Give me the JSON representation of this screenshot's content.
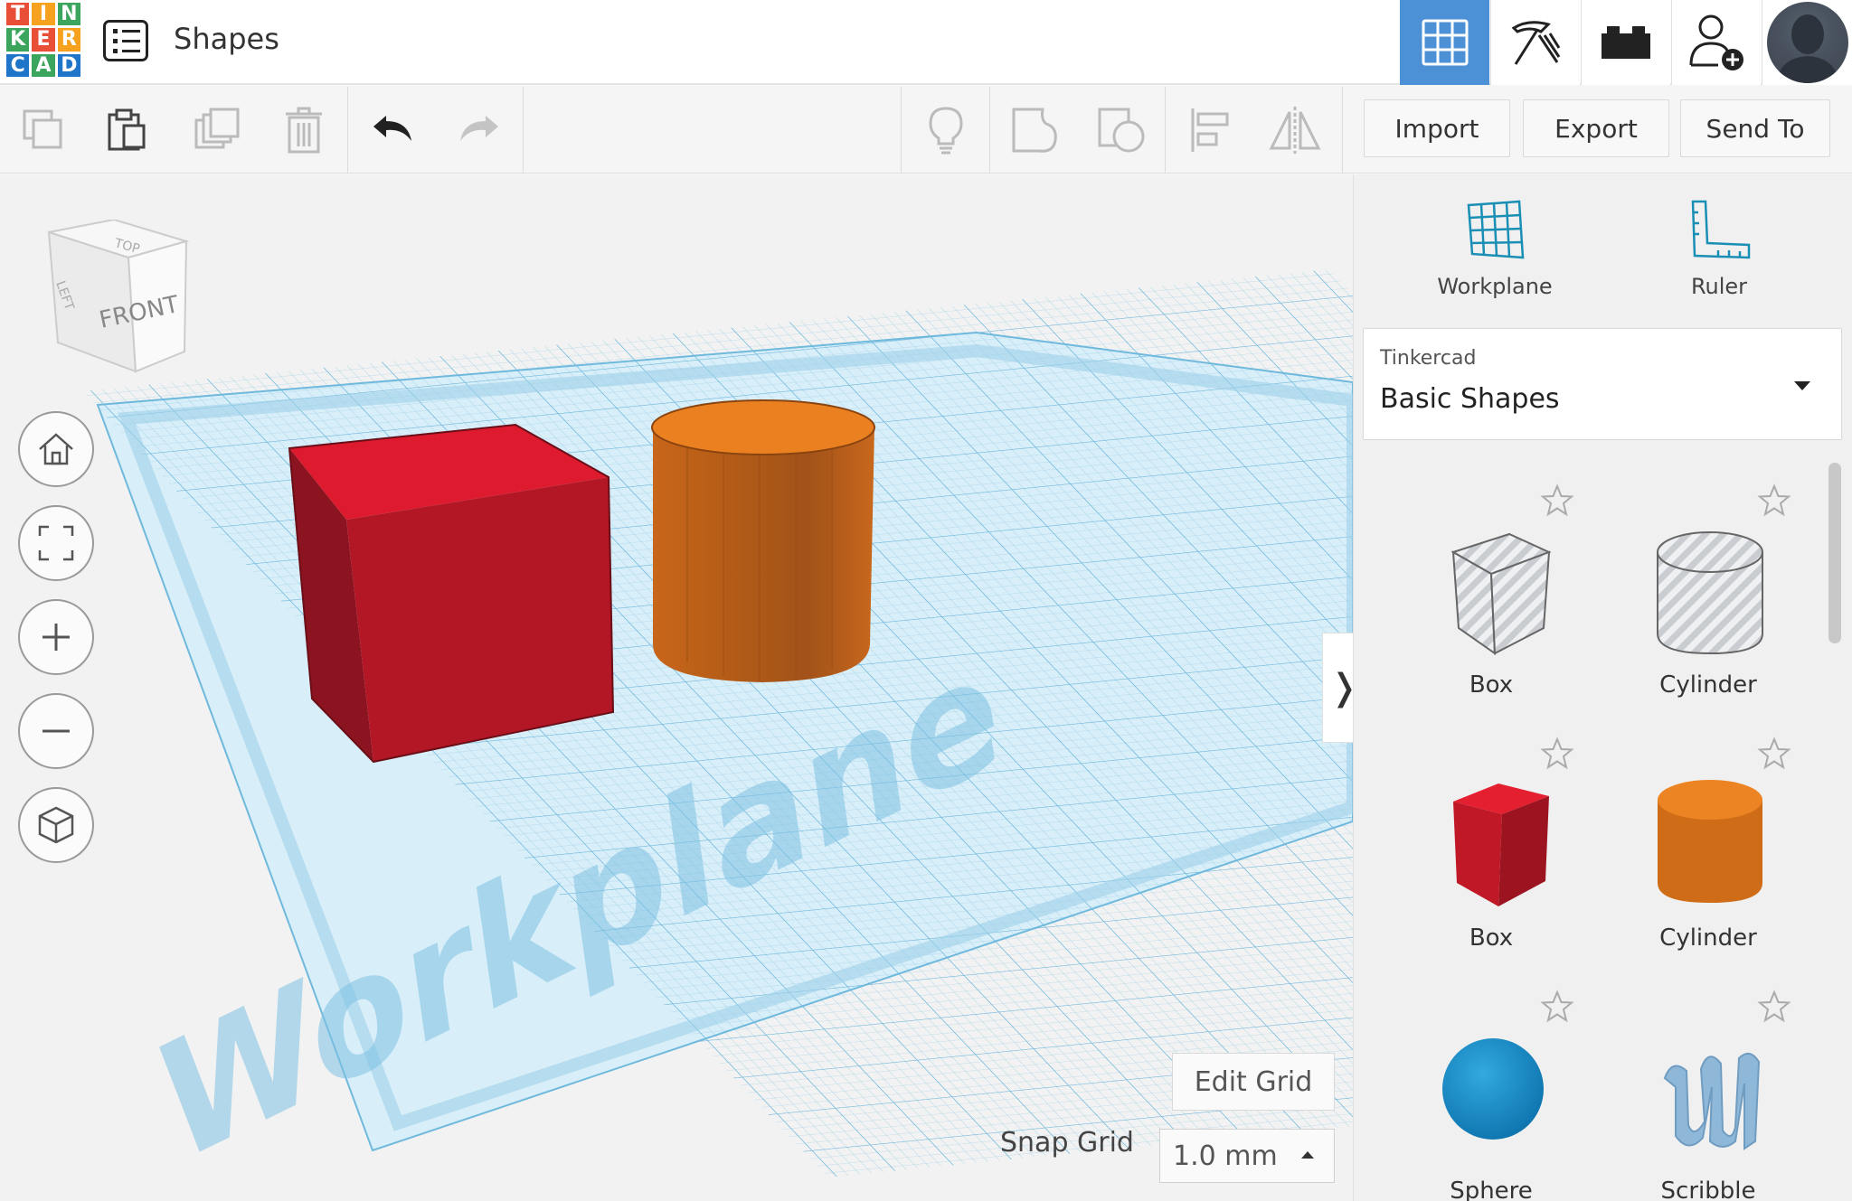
{
  "app": {
    "logo_letters": [
      "T",
      "I",
      "N",
      "K",
      "E",
      "R",
      "C",
      "A",
      "D"
    ],
    "logo_colors": [
      "#e94f37",
      "#f6a21e",
      "#3ba55d",
      "#3ba55d",
      "#e94f37",
      "#f6a21e",
      "#1f75c7",
      "#3ba55d",
      "#1f75c7"
    ],
    "design_title": "Shapes",
    "accent": "#4c90d5"
  },
  "nav": {
    "items": [
      {
        "name": "3d-design-icon",
        "active": true
      },
      {
        "name": "codeblocks-icon",
        "active": false
      },
      {
        "name": "bricks-icon",
        "active": false
      },
      {
        "name": "invite-user-icon",
        "active": false
      },
      {
        "name": "avatar",
        "active": false
      }
    ]
  },
  "toolbar": {
    "import_label": "Import",
    "export_label": "Export",
    "send_to_label": "Send To"
  },
  "viewport": {
    "view_cube_front": "FRONT",
    "view_cube_top": "TOP",
    "view_cube_left": "LEFT",
    "workplane_watermark": "Workplane",
    "edit_grid_label": "Edit Grid",
    "snap_grid_label": "Snap Grid",
    "snap_grid_value": "1.0 mm",
    "collapse_glyph": "❭"
  },
  "panel": {
    "workplane_label": "Workplane",
    "ruler_label": "Ruler",
    "library_category": "Tinkercad",
    "library_name": "Basic Shapes",
    "shapes": [
      {
        "label": "Box",
        "kind": "hole-box"
      },
      {
        "label": "Cylinder",
        "kind": "hole-cylinder"
      },
      {
        "label": "Box",
        "kind": "box"
      },
      {
        "label": "Cylinder",
        "kind": "cylinder"
      },
      {
        "label": "Sphere",
        "kind": "sphere"
      },
      {
        "label": "Scribble",
        "kind": "scribble"
      }
    ],
    "colors": {
      "box": "#c81d2a",
      "cylinder": "#e07b1a",
      "sphere": "#1a8fcf",
      "scribble": "#8fb8d8"
    }
  }
}
